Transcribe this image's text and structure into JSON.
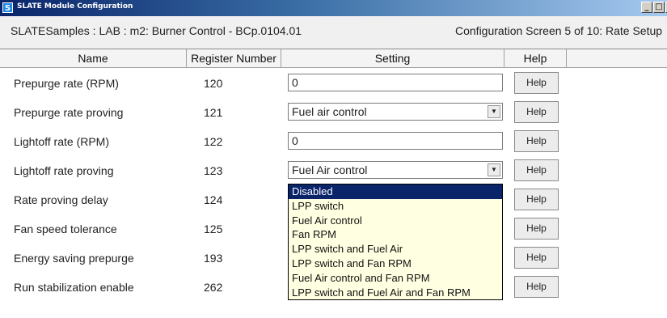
{
  "window": {
    "title": "SLATE Module Configuration",
    "icon_letter": "S",
    "buttons": [
      "_",
      "□",
      "x"
    ]
  },
  "breadcrumb": "SLATESamples : LAB : m2: Burner Control - BCp.0104.01",
  "screen_info": "Configuration Screen 5 of 10: Rate Setup",
  "columns": {
    "name": "Name",
    "register": "Register Number",
    "setting": "Setting",
    "help": "Help"
  },
  "rows": [
    {
      "name": "Prepurge rate (RPM)",
      "register": "120",
      "type": "text",
      "value": "0",
      "help": "Help"
    },
    {
      "name": "Prepurge rate proving",
      "register": "121",
      "type": "select",
      "value": "Fuel air control",
      "help": "Help"
    },
    {
      "name": "Lightoff rate (RPM)",
      "register": "122",
      "type": "text",
      "value": "0",
      "help": "Help"
    },
    {
      "name": "Lightoff rate proving",
      "register": "123",
      "type": "select",
      "value": "Fuel Air control",
      "help": "Help"
    },
    {
      "name": "Rate proving delay",
      "register": "124",
      "type": "hidden",
      "value": "",
      "help": "Help"
    },
    {
      "name": "Fan speed tolerance",
      "register": "125",
      "type": "hidden",
      "value": "",
      "help": "Help"
    },
    {
      "name": "Energy saving prepurge",
      "register": "193",
      "type": "hidden",
      "value": "",
      "help": "Help"
    },
    {
      "name": "Run stabilization enable",
      "register": "262",
      "type": "hidden",
      "value": "",
      "help": "Help"
    }
  ],
  "dropdown": {
    "selected_index": 0,
    "options": [
      "Disabled",
      "LPP switch",
      "Fuel Air control",
      "Fan RPM",
      "LPP switch and Fuel Air",
      "LPP switch and Fan RPM",
      "Fuel Air control and Fan RPM",
      "LPP switch and Fuel Air and Fan RPM"
    ]
  }
}
